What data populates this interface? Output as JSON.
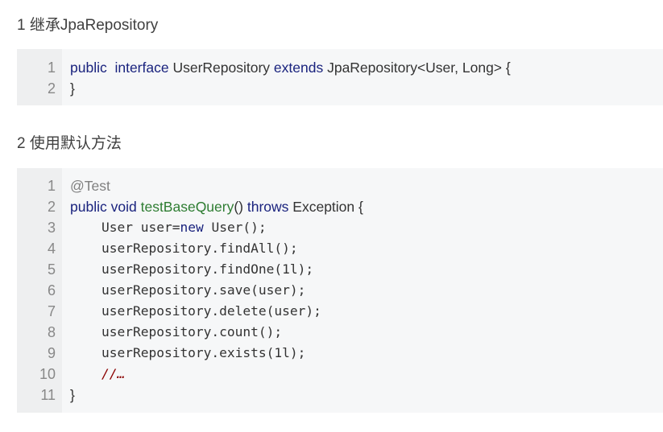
{
  "sections": [
    {
      "heading": "1 继承JpaRepository",
      "lines": [
        {
          "num": "1",
          "tokens": [
            {
              "t": "public",
              "c": "kw"
            },
            {
              "t": "  ",
              "c": "txt"
            },
            {
              "t": "interface",
              "c": "kw"
            },
            {
              "t": " UserRepository ",
              "c": "txt"
            },
            {
              "t": "extends",
              "c": "kw"
            },
            {
              "t": " JpaRepository<User, Long> {",
              "c": "txt"
            }
          ]
        },
        {
          "num": "2",
          "tokens": [
            {
              "t": "}",
              "c": "txt"
            }
          ]
        }
      ]
    },
    {
      "heading": "2 使用默认方法",
      "lines": [
        {
          "num": "1",
          "tokens": [
            {
              "t": "@Test",
              "c": "ann"
            }
          ]
        },
        {
          "num": "2",
          "tokens": [
            {
              "t": "public",
              "c": "kw"
            },
            {
              "t": " ",
              "c": "txt"
            },
            {
              "t": "void",
              "c": "kw"
            },
            {
              "t": " ",
              "c": "txt"
            },
            {
              "t": "testBaseQuery",
              "c": "fn"
            },
            {
              "t": "() ",
              "c": "txt"
            },
            {
              "t": "throws",
              "c": "kw"
            },
            {
              "t": " Exception {",
              "c": "txt"
            }
          ]
        },
        {
          "num": "3",
          "mono": true,
          "tokens": [
            {
              "t": "    User user=",
              "c": "txt"
            },
            {
              "t": "new",
              "c": "kw"
            },
            {
              "t": " User();",
              "c": "txt"
            }
          ]
        },
        {
          "num": "4",
          "mono": true,
          "tokens": [
            {
              "t": "    userRepository.findAll();",
              "c": "txt"
            }
          ]
        },
        {
          "num": "5",
          "mono": true,
          "tokens": [
            {
              "t": "    userRepository.findOne(1l);",
              "c": "txt"
            }
          ]
        },
        {
          "num": "6",
          "mono": true,
          "tokens": [
            {
              "t": "    userRepository.save(user);",
              "c": "txt"
            }
          ]
        },
        {
          "num": "7",
          "mono": true,
          "tokens": [
            {
              "t": "    userRepository.delete(user);",
              "c": "txt"
            }
          ]
        },
        {
          "num": "8",
          "mono": true,
          "tokens": [
            {
              "t": "    userRepository.count();",
              "c": "txt"
            }
          ]
        },
        {
          "num": "9",
          "mono": true,
          "tokens": [
            {
              "t": "    userRepository.exists(1l);",
              "c": "txt"
            }
          ]
        },
        {
          "num": "10",
          "mono": true,
          "tokens": [
            {
              "t": "    ",
              "c": "txt"
            },
            {
              "t": "//…",
              "c": "cmt"
            }
          ]
        },
        {
          "num": "11",
          "tokens": [
            {
              "t": "}",
              "c": "txt"
            }
          ]
        }
      ]
    }
  ]
}
